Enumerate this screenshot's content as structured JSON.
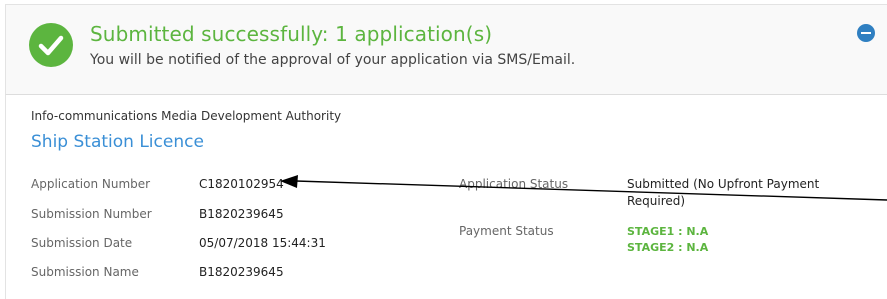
{
  "banner": {
    "title": "Submitted successfully: 1 application(s)",
    "subtitle": "You will be notified of the approval of your application via SMS/Email.",
    "icon": "check-circle-icon",
    "collapse_icon": "minus-circle-icon"
  },
  "application": {
    "agency": "Info-communications Media Development Authority",
    "licence_name": "Ship Station Licence",
    "fields_left": [
      {
        "label": "Application Number",
        "value": "C1820102954"
      },
      {
        "label": "Submission Number",
        "value": "B1820239645"
      },
      {
        "label": "Submission Date",
        "value": "05/07/2018 15:44:31"
      },
      {
        "label": "Submission Name",
        "value": "B1820239645"
      }
    ],
    "application_status": {
      "label": "Application Status",
      "value": "Submitted (No Upfront Payment Required)"
    },
    "payment_status": {
      "label": "Payment Status",
      "stage1": "STAGE1 : N.A",
      "stage2": "STAGE2 : N.A"
    }
  },
  "colors": {
    "success": "#5cb53f",
    "link": "#3a8fd6",
    "accent": "#2f7fc1"
  }
}
